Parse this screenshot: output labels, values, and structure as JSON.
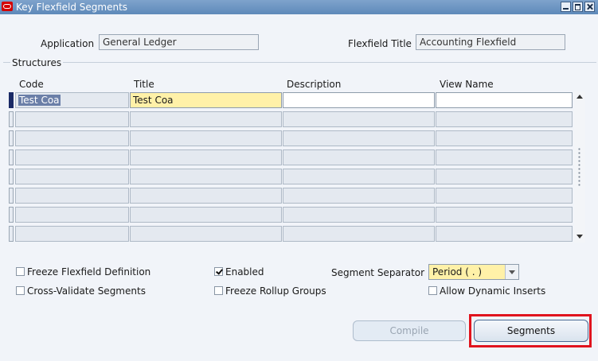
{
  "window": {
    "title": "Key Flexfield Segments"
  },
  "header": {
    "application_label": "Application",
    "application_value": "General Ledger",
    "flexfield_title_label": "Flexfield Title",
    "flexfield_title_value": "Accounting Flexfield"
  },
  "structures": {
    "section_label": "Structures",
    "columns": [
      "Code",
      "Title",
      "Description",
      "View Name"
    ],
    "rows": [
      {
        "code": "Test Coa",
        "title": "Test Coa",
        "description": "",
        "view_name": ""
      },
      {
        "code": "",
        "title": "",
        "description": "",
        "view_name": ""
      },
      {
        "code": "",
        "title": "",
        "description": "",
        "view_name": ""
      },
      {
        "code": "",
        "title": "",
        "description": "",
        "view_name": ""
      },
      {
        "code": "",
        "title": "",
        "description": "",
        "view_name": ""
      },
      {
        "code": "",
        "title": "",
        "description": "",
        "view_name": ""
      },
      {
        "code": "",
        "title": "",
        "description": "",
        "view_name": ""
      },
      {
        "code": "",
        "title": "",
        "description": "",
        "view_name": ""
      }
    ]
  },
  "options": {
    "freeze_flexfield_definition": {
      "label": "Freeze Flexfield Definition",
      "checked": false
    },
    "cross_validate_segments": {
      "label": "Cross-Validate Segments",
      "checked": false
    },
    "enabled": {
      "label": "Enabled",
      "checked": true
    },
    "freeze_rollup_groups": {
      "label": "Freeze Rollup Groups",
      "checked": false
    },
    "allow_dynamic_inserts": {
      "label": "Allow Dynamic Inserts",
      "checked": false
    },
    "segment_separator_label": "Segment Separator",
    "segment_separator_value": "Period ( . )"
  },
  "buttons": {
    "compile_label": "Compile",
    "segments_label": "Segments"
  },
  "colors": {
    "highlight": "#e0141e",
    "required_field": "#fff1a8",
    "titlebar": "#6a93c2"
  }
}
